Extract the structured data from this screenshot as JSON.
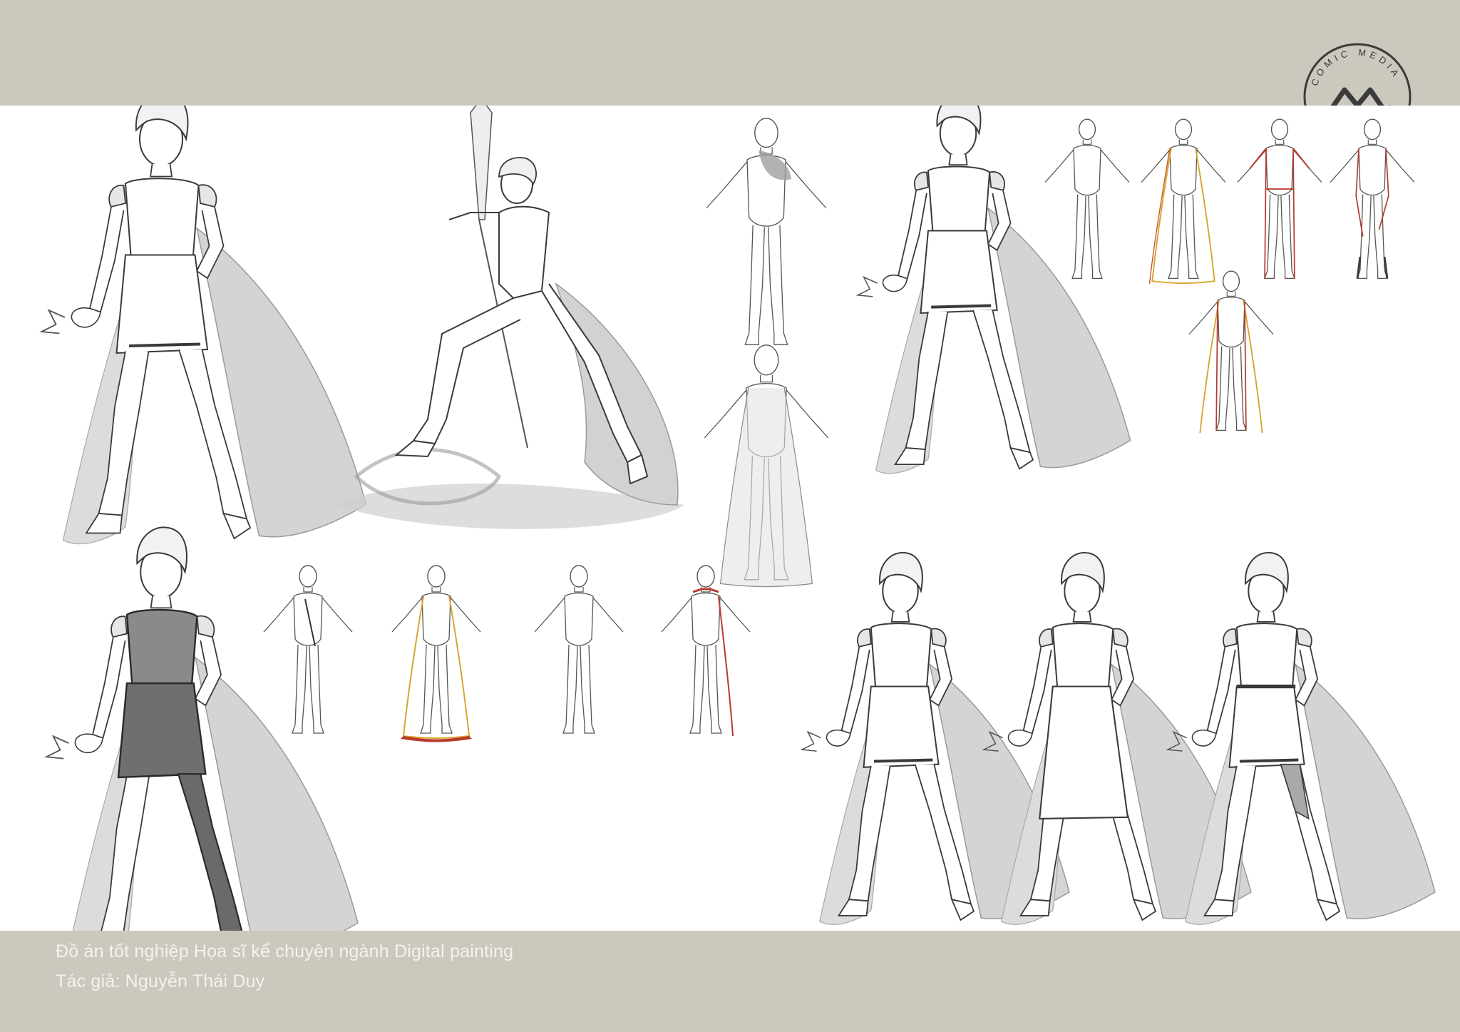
{
  "header": {
    "logo_text": "COMIC MEDIA ACADEMY VN"
  },
  "footer": {
    "project_line": "Đồ án tốt nghiệp Họa sĩ kể chuyện ngành Digital painting",
    "author_line": "Tác giả: Nguyễn Thái Duy"
  },
  "colors": {
    "band": "#cbc8bd",
    "sheet": "#ffffff",
    "line": "#3a3a3a",
    "cape_shade": "#c8c8c8",
    "accent_red": "#b83a2a",
    "accent_yellow": "#d9a531"
  }
}
